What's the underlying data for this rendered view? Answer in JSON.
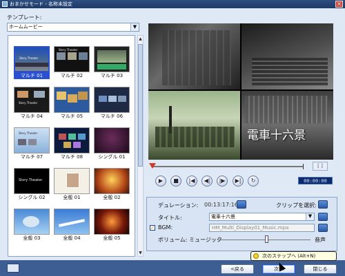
{
  "window": {
    "title": "おまかせモード - 名称未設定"
  },
  "template": {
    "label": "テンプレート:",
    "selected": "ホームムービー",
    "items": [
      {
        "label": "マルチ 01",
        "overlay": "Story Theater"
      },
      {
        "label": "マルチ 02",
        "overlay": "Story Theater"
      },
      {
        "label": "マルチ 03",
        "overlay": ""
      },
      {
        "label": "マルチ 04",
        "overlay": "Story Theater"
      },
      {
        "label": "マルチ 05",
        "overlay": ""
      },
      {
        "label": "マルチ 06",
        "overlay": ""
      },
      {
        "label": "マルチ 07",
        "overlay": "Story Theater"
      },
      {
        "label": "マルチ 08",
        "overlay": ""
      },
      {
        "label": "シングル 01",
        "overlay": ""
      },
      {
        "label": "シングル 02",
        "overlay": "Story Theater"
      },
      {
        "label": "全般 01",
        "overlay": ""
      },
      {
        "label": "全般 02",
        "overlay": ""
      },
      {
        "label": "全般 03",
        "overlay": ""
      },
      {
        "label": "全般 04",
        "overlay": ""
      },
      {
        "label": "全般 05",
        "overlay": ""
      }
    ]
  },
  "preview": {
    "overlay_title": "電車十六景",
    "timecode": "00:00:00"
  },
  "settings": {
    "duration_label": "デュレーション:",
    "duration_value": "00:13:17:16",
    "clip_select_label": "クリップを選択:",
    "title_label": "タイトル:",
    "title_value": "電車十六景",
    "bgm_label": "BGM:",
    "bgm_value": "HM_Multi_Display01_Music.mpa",
    "volume_label": "ボリューム: ミュージック",
    "volume_right_label": "音声"
  },
  "buttons": {
    "back": "<戻る",
    "next": "次へ",
    "close": "閉じる"
  },
  "tooltip": "次のステップへ (Alt+N)",
  "colors": {
    "selection": "#2a4fd1",
    "bottom_bar": "#3d5e93",
    "title_bar": "#1d3a66"
  },
  "icons": [
    "help-icon",
    "play-icon",
    "stop-icon",
    "prev-icon",
    "step-back-icon",
    "step-forward-icon",
    "next-icon",
    "loop-icon",
    "info-icon"
  ]
}
